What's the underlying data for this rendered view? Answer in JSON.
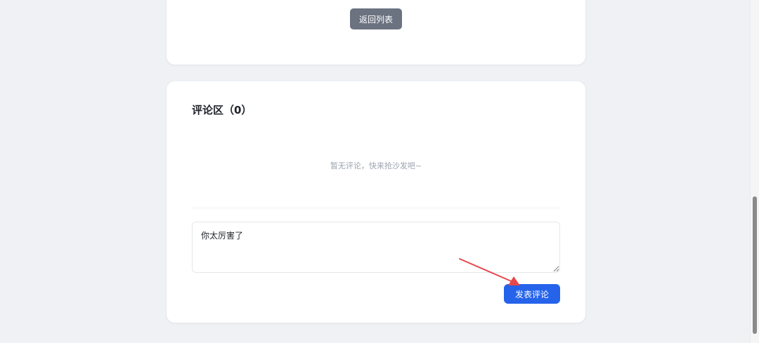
{
  "top_card": {
    "back_button_label": "返回列表"
  },
  "comments": {
    "title": "评论区（0）",
    "empty_text": "暂无评论，快来抢沙发吧~",
    "input_value": "你太厉害了",
    "submit_label": "发表评论"
  },
  "colors": {
    "back_button": "#6b7280",
    "submit_button": "#2563eb",
    "annotation_arrow": "#e5484d",
    "page_background": "#f0f1f5"
  }
}
